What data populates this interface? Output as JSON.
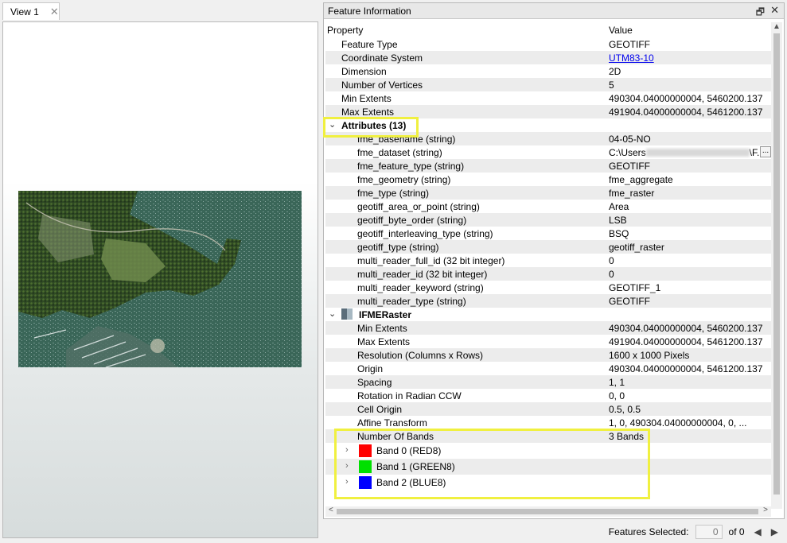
{
  "view": {
    "tab_label": "View 1",
    "close_glyph": "✕"
  },
  "panel": {
    "title": "Feature Information",
    "float_glyph": "🗗",
    "close_glyph": "✕"
  },
  "columns": {
    "property": "Property",
    "value": "Value"
  },
  "general": [
    {
      "prop": "Feature Type",
      "val": "GEOTIFF"
    },
    {
      "prop": "Coordinate System",
      "val": "UTM83-10",
      "link": true
    },
    {
      "prop": "Dimension",
      "val": "2D"
    },
    {
      "prop": "Number of Vertices",
      "val": "5"
    },
    {
      "prop": "Min Extents",
      "val": "490304.04000000004, 5460200.137"
    },
    {
      "prop": "Max Extents",
      "val": "491904.04000000004, 5461200.137"
    }
  ],
  "attributes_group": "Attributes (13)",
  "attributes": [
    {
      "prop": "fme_basename (string)",
      "val": "04-05-NO"
    },
    {
      "prop": "fme_dataset (string)",
      "val_prefix": "C:\\Users",
      "val_suffix": "\\F...",
      "more": "..."
    },
    {
      "prop": "fme_feature_type (string)",
      "val": "GEOTIFF"
    },
    {
      "prop": "fme_geometry (string)",
      "val": "fme_aggregate"
    },
    {
      "prop": "fme_type (string)",
      "val": "fme_raster"
    },
    {
      "prop": "geotiff_area_or_point (string)",
      "val": "Area"
    },
    {
      "prop": "geotiff_byte_order (string)",
      "val": "LSB"
    },
    {
      "prop": "geotiff_interleaving_type (string)",
      "val": "BSQ"
    },
    {
      "prop": "geotiff_type (string)",
      "val": "geotiff_raster"
    },
    {
      "prop": "multi_reader_full_id (32 bit integer)",
      "val": "0"
    },
    {
      "prop": "multi_reader_id (32 bit integer)",
      "val": "0"
    },
    {
      "prop": "multi_reader_keyword (string)",
      "val": "GEOTIFF_1"
    },
    {
      "prop": "multi_reader_type (string)",
      "val": "GEOTIFF"
    }
  ],
  "raster_group": "IFMERaster",
  "raster": [
    {
      "prop": "Min Extents",
      "val": "490304.04000000004, 5460200.137"
    },
    {
      "prop": "Max Extents",
      "val": "491904.04000000004, 5461200.137"
    },
    {
      "prop": "Resolution (Columns x Rows)",
      "val": "1600 x 1000 Pixels"
    },
    {
      "prop": "Origin",
      "val": "490304.04000000004, 5461200.137"
    },
    {
      "prop": "Spacing",
      "val": "1, 1"
    },
    {
      "prop": "Rotation in Radian CCW",
      "val": "0, 0"
    },
    {
      "prop": "Cell Origin",
      "val": "0.5, 0.5"
    },
    {
      "prop": "Affine Transform",
      "val": "1, 0, 490304.04000000004, 0, ..."
    },
    {
      "prop": "Number Of Bands",
      "val": "3 Bands"
    }
  ],
  "bands": [
    {
      "label": "Band 0 (RED8)",
      "color": "#ff0000"
    },
    {
      "label": "Band 1 (GREEN8)",
      "color": "#00e000"
    },
    {
      "label": "Band 2 (BLUE8)",
      "color": "#0000ff"
    }
  ],
  "status": {
    "label": "Features Selected:",
    "count": "0",
    "of": "of 0"
  },
  "icons": {
    "expand_open": "chevron-down-icon",
    "expand_closed": "chevron-right-icon",
    "raster": "raster-icon"
  }
}
